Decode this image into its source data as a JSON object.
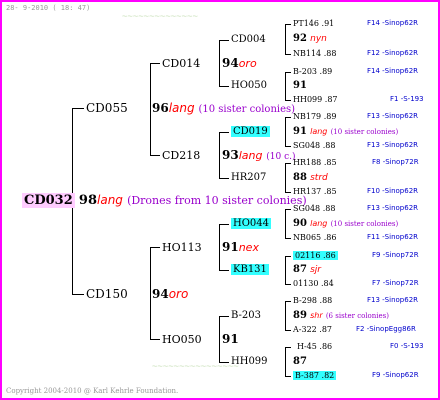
{
  "header": {
    "timestamp": "28- 9-2010 ( 18: 47)"
  },
  "footer": {
    "copyright": "Copyright 2004-2010 @ Karl Kehrle Foundation."
  },
  "root": {
    "id": "CD032",
    "gen_num": "98",
    "race": "lang",
    "note": "(Drones from 10 sister colonies)"
  },
  "gen1": [
    {
      "id": "CD055",
      "gen_num": "96",
      "race": "lang",
      "note": "(10 sister colonies)"
    },
    {
      "id": "CD150",
      "gen_num": "94",
      "race": "oro",
      "note": ""
    }
  ],
  "gen2": [
    {
      "id": "CD014",
      "gen_num": "94",
      "race": "oro",
      "note": ""
    },
    {
      "id": "CD218",
      "gen_num": "93",
      "race": "lang",
      "note": "(10 c.)"
    },
    {
      "id": "HO113",
      "gen_num": "91",
      "race": "nex",
      "note": ""
    },
    {
      "id": "HO050",
      "gen_num": "91",
      "race": "",
      "note": ""
    }
  ],
  "gen3": [
    {
      "id": "CD004",
      "gen_num": "92",
      "race": "nyn",
      "note": ""
    },
    {
      "id": "HO050",
      "gen_num": "91",
      "race": "",
      "note": ""
    },
    {
      "id": "CD019",
      "gen_num": "91",
      "race": "lang",
      "note": "(10 sister colonies)"
    },
    {
      "id": "HR207",
      "gen_num": "88",
      "race": "strd",
      "note": ""
    },
    {
      "id": "HO044",
      "gen_num": "90",
      "race": "lang",
      "note": "(10 sister colonies)"
    },
    {
      "id": "KB131",
      "gen_num": "87",
      "race": "sjr",
      "note": ""
    },
    {
      "id": "B-203",
      "gen_num": "89",
      "race": "shr",
      "note": "(6 sister colonies)"
    },
    {
      "id": "HH099",
      "gen_num": "87",
      "race": "",
      "note": ""
    }
  ],
  "gen4": [
    {
      "id": "PT146",
      "val": ".91",
      "ref": "F14 -Sinop62R"
    },
    {
      "id": "NB114",
      "val": ".88",
      "ref": "F12 -Sinop62R"
    },
    {
      "id": "B-203",
      "val": ".89",
      "ref": "F14 -Sinop62R"
    },
    {
      "id": "HH099",
      "val": ".87",
      "ref": "F1 -S-193"
    },
    {
      "id": "NB179",
      "val": ".89",
      "ref": "F13 -Sinop62R"
    },
    {
      "id": "SG048",
      "val": ".88",
      "ref": "F13 -Sinop62R"
    },
    {
      "id": "HR188",
      "val": ".85",
      "ref": "F8 -Sinop72R"
    },
    {
      "id": "HR137",
      "val": ".85",
      "ref": "F10 -Sinop62R"
    },
    {
      "id": "SG048",
      "val": ".88",
      "ref": "F13 -Sinop62R"
    },
    {
      "id": "NB065",
      "val": ".86",
      "ref": "F11 -Sinop62R"
    },
    {
      "id": "02116",
      "val": ".86",
      "ref": "F9 -Sinop72R"
    },
    {
      "id": "01130",
      "val": ".84",
      "ref": "F7 -Sinop72R"
    },
    {
      "id": "B-298",
      "val": ".88",
      "ref": "F13 -Sinop62R"
    },
    {
      "id": "A-322",
      "val": ".87",
      "ref": "F2 -SinopEgg86R"
    },
    {
      "id": "H-45",
      "val": ".86",
      "ref": "F0 -S-193"
    },
    {
      "id": "B-387",
      "val": ".82",
      "ref": "F9 -Sinop62R"
    }
  ],
  "colors": {
    "border": "#ff00ff",
    "root_highlight": "#ffccff",
    "cyan_highlight": "#33ffff",
    "race": "#ff0000",
    "note": "#9900cc",
    "ref": "#0000cc"
  }
}
